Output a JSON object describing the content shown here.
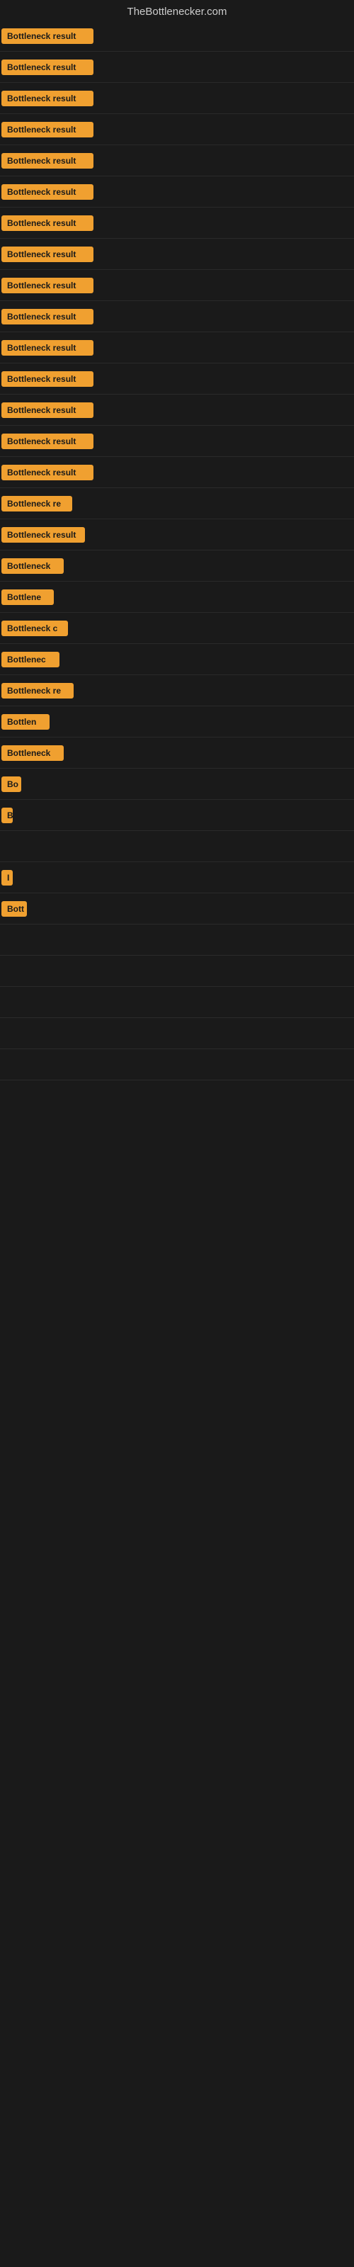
{
  "header": {
    "title": "TheBottlenecker.com"
  },
  "items": [
    {
      "label": "Bottleneck result",
      "width": 130
    },
    {
      "label": "Bottleneck result",
      "width": 130
    },
    {
      "label": "Bottleneck result",
      "width": 130
    },
    {
      "label": "Bottleneck result",
      "width": 130
    },
    {
      "label": "Bottleneck result",
      "width": 130
    },
    {
      "label": "Bottleneck result",
      "width": 130
    },
    {
      "label": "Bottleneck result",
      "width": 130
    },
    {
      "label": "Bottleneck result",
      "width": 130
    },
    {
      "label": "Bottleneck result",
      "width": 130
    },
    {
      "label": "Bottleneck result",
      "width": 130
    },
    {
      "label": "Bottleneck result",
      "width": 130
    },
    {
      "label": "Bottleneck result",
      "width": 130
    },
    {
      "label": "Bottleneck result",
      "width": 130
    },
    {
      "label": "Bottleneck result",
      "width": 130
    },
    {
      "label": "Bottleneck result",
      "width": 130
    },
    {
      "label": "Bottleneck re",
      "width": 100
    },
    {
      "label": "Bottleneck result",
      "width": 118
    },
    {
      "label": "Bottleneck",
      "width": 88
    },
    {
      "label": "Bottlene",
      "width": 74
    },
    {
      "label": "Bottleneck c",
      "width": 94
    },
    {
      "label": "Bottlenec",
      "width": 82
    },
    {
      "label": "Bottleneck re",
      "width": 102
    },
    {
      "label": "Bottlen",
      "width": 68
    },
    {
      "label": "Bottleneck",
      "width": 88
    },
    {
      "label": "Bo",
      "width": 28
    },
    {
      "label": "B",
      "width": 16
    },
    {
      "label": "",
      "width": 8
    },
    {
      "label": "I",
      "width": 10
    },
    {
      "label": "Bott",
      "width": 36
    },
    {
      "label": "",
      "width": 0
    },
    {
      "label": "",
      "width": 0
    },
    {
      "label": "",
      "width": 0
    },
    {
      "label": "",
      "width": 0
    },
    {
      "label": "",
      "width": 0
    }
  ],
  "colors": {
    "badge_bg": "#f0a030",
    "badge_text": "#1a1a1a",
    "page_bg": "#1a1a1a",
    "header_text": "#cccccc"
  }
}
